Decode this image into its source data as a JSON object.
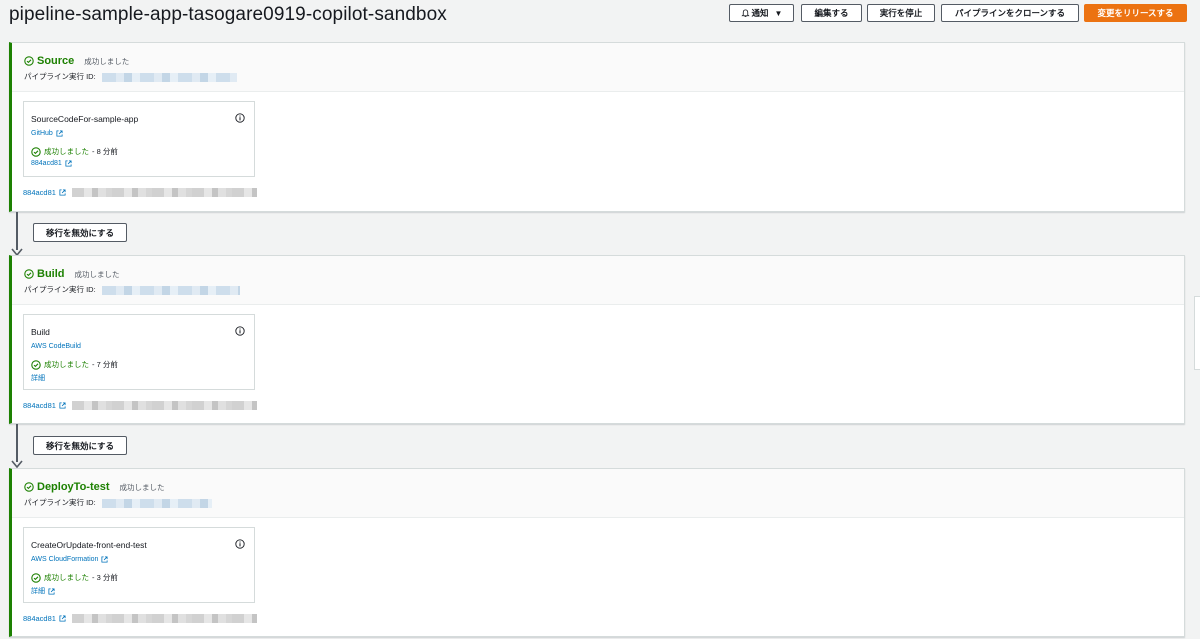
{
  "header": {
    "title": "pipeline-sample-app-tasogare0919-copilot-sandbox",
    "buttons": {
      "notify": "通知",
      "edit": "編集する",
      "stop": "実行を停止",
      "clone": "パイプラインをクローンする",
      "release": "変更をリリースする"
    }
  },
  "colors": {
    "success": "#1d8102",
    "link": "#0073bb",
    "primary": "#ec7211"
  },
  "transition": {
    "disable_label": "移行を無効にする"
  },
  "stages": [
    {
      "name": "Source",
      "status": "成功しました",
      "exec_label": "パイプライン実行 ID:",
      "action": {
        "name": "SourceCodeFor-sample-app",
        "provider": "GitHub",
        "status": "成功しました",
        "time": "- 8 分前",
        "link": "884acd81"
      },
      "commit": "884acd81"
    },
    {
      "name": "Build",
      "status": "成功しました",
      "exec_label": "パイプライン実行 ID:",
      "action": {
        "name": "Build",
        "provider": "AWS CodeBuild",
        "status": "成功しました",
        "time": "- 7 分前",
        "link": "詳細"
      },
      "commit": "884acd81"
    },
    {
      "name": "DeployTo-test",
      "status": "成功しました",
      "exec_label": "パイプライン実行 ID:",
      "action": {
        "name": "CreateOrUpdate-front-end-test",
        "provider": "AWS CloudFormation",
        "status": "成功しました",
        "time": "- 3 分前",
        "link": "詳細"
      },
      "commit": "884acd81"
    }
  ]
}
